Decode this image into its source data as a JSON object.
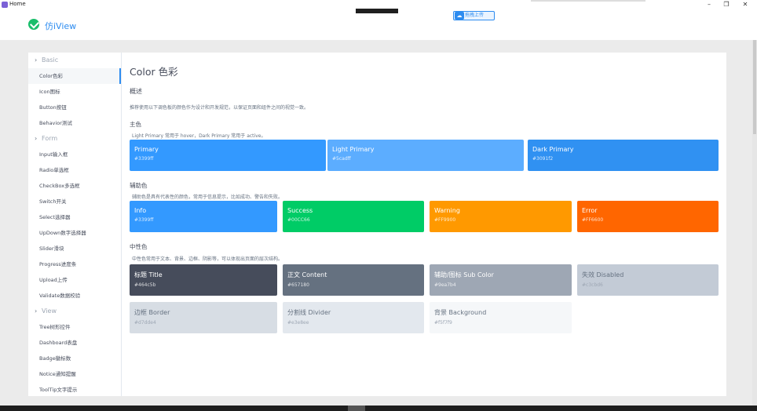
{
  "window": {
    "title": "Home",
    "minimize": "–",
    "maximize": "❐",
    "close": "✕"
  },
  "header": {
    "brand": "仿iView",
    "upload_label": "拖拽上传"
  },
  "sidebar": {
    "groups": [
      {
        "label": "Basic",
        "items": [
          "Color色彩",
          "Icon图标",
          "Button按钮",
          "Behavior测试"
        ]
      },
      {
        "label": "Form",
        "items": [
          "Input输入框",
          "Radio单选框",
          "CheckBox多选框",
          "Switch开关",
          "Select选择器",
          "UpDown数字选择器",
          "Slider滑块",
          "Progress进度条",
          "Upload上传",
          "Validate数据校验"
        ]
      },
      {
        "label": "View",
        "items": [
          "Tree树形控件",
          "Dashboard表盘",
          "Badge徽标数",
          "Notice通知提醒",
          "ToolTip文字提示"
        ]
      }
    ],
    "active": "Color色彩"
  },
  "main": {
    "title": "Color 色彩",
    "overview": {
      "title": "概述",
      "desc": "推荐使用以下调色板的颜色作为设计和开发规范，以保证页面和组件之间的视觉一致。"
    },
    "primary": {
      "title": "主色",
      "desc": "Light Primary 常用于 hover，Dark Primary 常用于 active。",
      "swatches": [
        {
          "name": "Primary",
          "hex": "#3399ff",
          "color": "#3399ff"
        },
        {
          "name": "Light Primary",
          "hex": "#5cadff",
          "color": "#5cadff"
        },
        {
          "name": "Dark Primary",
          "hex": "#3091f2",
          "color": "#3091f2"
        }
      ]
    },
    "aux": {
      "title": "辅助色",
      "desc": "辅助色是具有代表性的颜色，常用于信息提示，比如成功、警告和失败。",
      "swatches": [
        {
          "name": "Info",
          "hex": "#3399ff",
          "color": "#3399ff"
        },
        {
          "name": "Success",
          "hex": "#00CC66",
          "color": "#00cc66"
        },
        {
          "name": "Warning",
          "hex": "#FF9900",
          "color": "#ff9900"
        },
        {
          "name": "Error",
          "hex": "#FF6600",
          "color": "#ff6600"
        }
      ]
    },
    "neutral": {
      "title": "中性色",
      "desc": "中性色常用于文本、背景、边框、阴影等，可以体现出页面的层次结构。",
      "swatches": [
        {
          "name": "标题 Title",
          "hex": "#464c5b",
          "color": "#464c5b"
        },
        {
          "name": "正文 Content",
          "hex": "#657180",
          "color": "#657180"
        },
        {
          "name": "辅助/图标 Sub Color",
          "hex": "#9ea7b4",
          "color": "#9ea7b4"
        },
        {
          "name": "失效 Disabled",
          "hex": "#c3cbd6",
          "color": "#c3cbd6"
        },
        {
          "name": "边框 Border",
          "hex": "#d7dde4",
          "color": "#d7dde4"
        },
        {
          "name": "分割线 Divider",
          "hex": "#e3e8ee",
          "color": "#e3e8ee"
        },
        {
          "name": "背景 Background",
          "hex": "#f5f7f9",
          "color": "#f5f7f9"
        }
      ]
    }
  }
}
